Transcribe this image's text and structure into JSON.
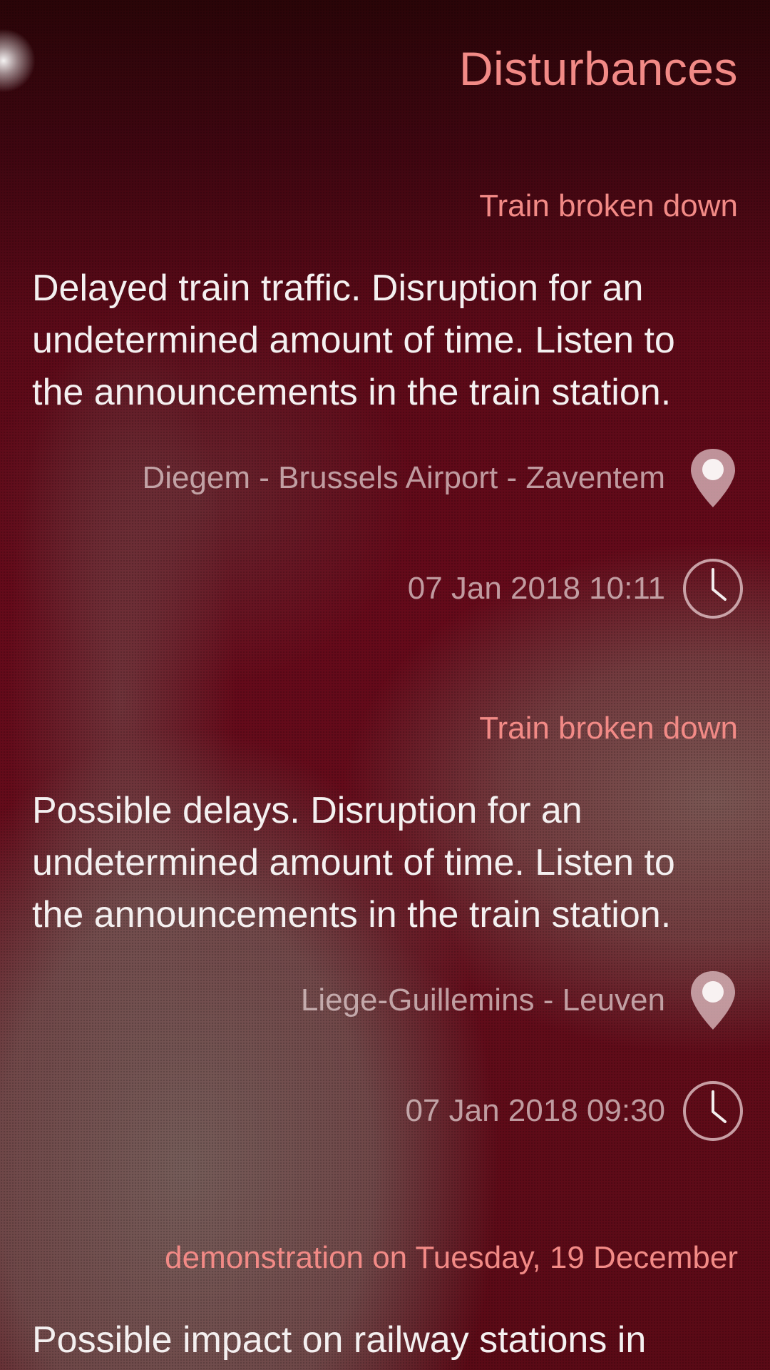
{
  "header": {
    "title": "Disturbances"
  },
  "disturbances": [
    {
      "title": "Train broken down",
      "description": "Delayed train traffic. Disruption for an undetermined amount of time. Listen to the announcements in the train station.",
      "location": "Diegem - Brussels Airport - Zaventem",
      "location_icon": "location-pin-icon",
      "timestamp": "07 Jan 2018 10:11",
      "time_icon": "clock-icon"
    },
    {
      "title": "Train broken down",
      "description": "Possible delays. Disruption for an undetermined amount of time. Listen to the announcements in the train station.",
      "location": "Liege-Guillemins - Leuven",
      "location_icon": "location-pin-icon",
      "timestamp": "07 Jan 2018 09:30",
      "time_icon": "clock-icon"
    },
    {
      "title": "demonstration on Tuesday, 19 December",
      "description": "Possible impact on railway stations in"
    }
  ],
  "colors": {
    "accent": "#f28a86",
    "primary_text": "#f4f0f0",
    "secondary_text": "#e6d2d4",
    "background": "#5a0a14"
  }
}
